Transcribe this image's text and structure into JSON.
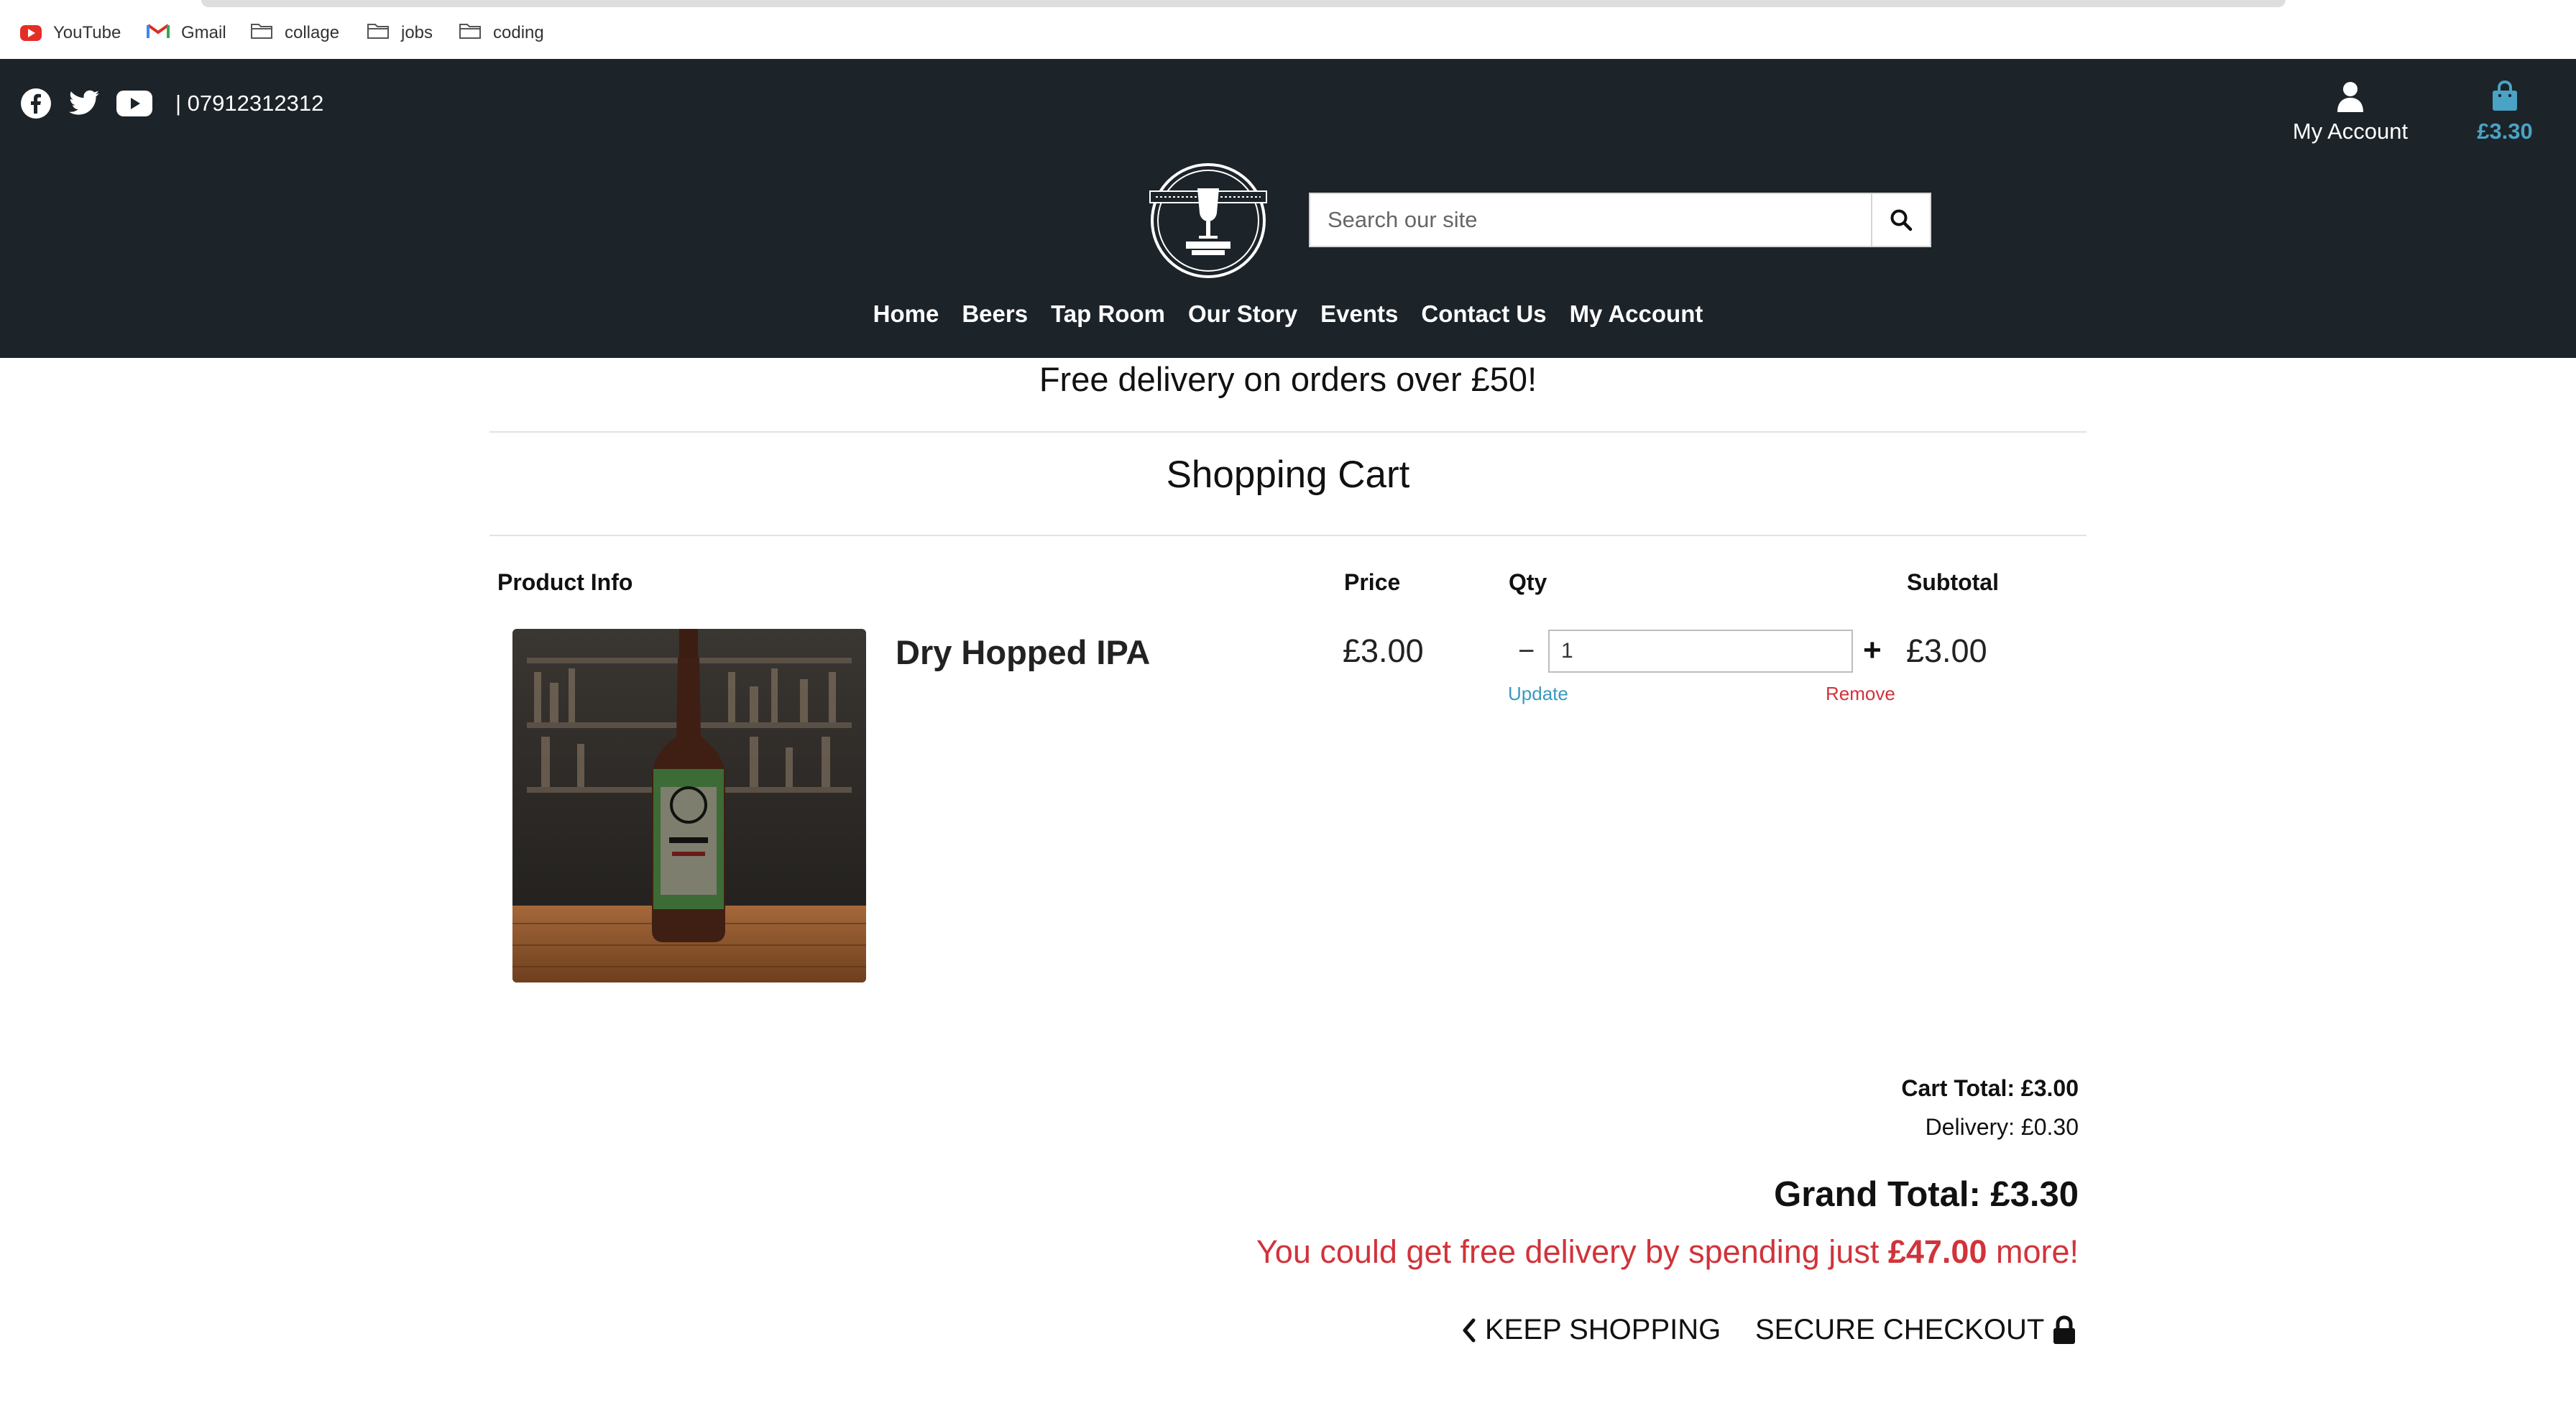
{
  "bookmarks": [
    {
      "label": "YouTube",
      "icon": "youtube-icon"
    },
    {
      "label": "Gmail",
      "icon": "gmail-icon"
    },
    {
      "label": "collage",
      "icon": "folder-icon"
    },
    {
      "label": "jobs",
      "icon": "folder-icon"
    },
    {
      "label": "coding",
      "icon": "folder-icon"
    }
  ],
  "header": {
    "social_icons": [
      "facebook-icon",
      "twitter-icon",
      "youtube-icon"
    ],
    "phone": "| 07912312312",
    "account_label": "My Account",
    "cart_amount": "£3.30",
    "search_placeholder": "Search our site",
    "logo_alt": "brewery-logo"
  },
  "nav": {
    "items": [
      "Home",
      "Beers",
      "Tap Room",
      "Our Story",
      "Events",
      "Contact Us",
      "My Account"
    ]
  },
  "promo": "Free delivery on orders over £50!",
  "page_title": "Shopping Cart",
  "table": {
    "headers": {
      "product": "Product Info",
      "price": "Price",
      "qty": "Qty",
      "subtotal": "Subtotal"
    },
    "rows": [
      {
        "name": "Dry Hopped IPA",
        "price": "£3.00",
        "qty": "1",
        "subtotal": "£3.00",
        "update_label": "Update",
        "remove_label": "Remove",
        "minus_label": "−",
        "plus_label": "+"
      }
    ]
  },
  "summary": {
    "cart_total": "Cart Total: £3.00",
    "delivery": "Delivery: £0.30",
    "grand_total": "Grand Total: £3.30",
    "upsell_prefix": "You could get free delivery by spending just ",
    "upsell_amount": "£47.00",
    "upsell_suffix": " more!"
  },
  "actions": {
    "keep_shopping": "KEEP SHOPPING",
    "secure_checkout": "SECURE CHECKOUT"
  },
  "colors": {
    "header_bg": "#1c2329",
    "accent_blue": "#4aa3c4",
    "danger_red": "#d1333a"
  }
}
